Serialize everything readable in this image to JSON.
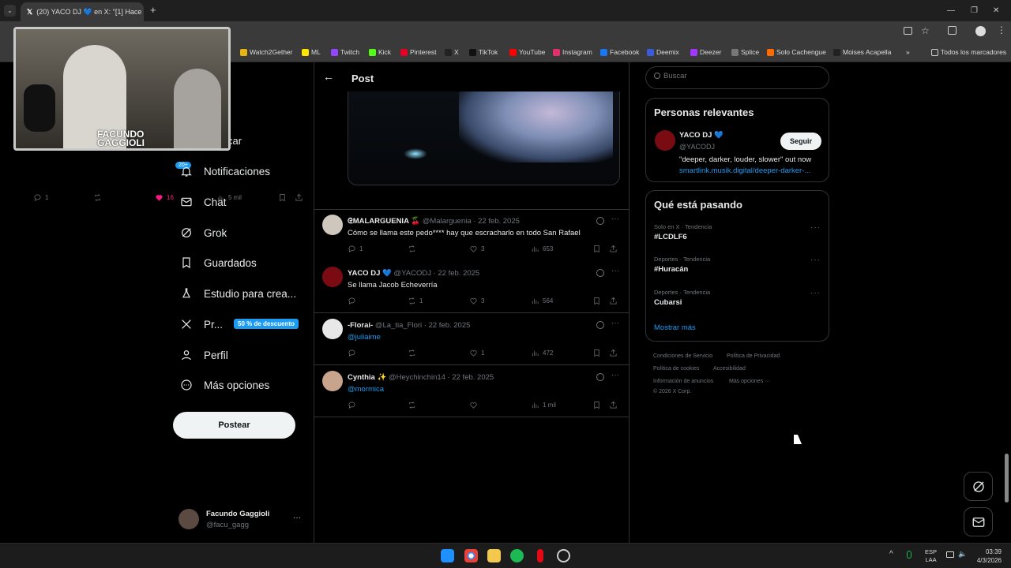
{
  "browser": {
    "tab_title": "(20) YACO DJ 💙 en X: \"[1] Hace",
    "bookmarks": [
      "Watch2Gether",
      "ML",
      "Twitch",
      "Kick",
      "Pinterest",
      "X",
      "TikTok",
      "YouTube",
      "Instagram",
      "Facebook",
      "Deemix",
      "Deezer",
      "Splice",
      "Solo Cachengue",
      "Moises Acapella"
    ],
    "all_bookmarks": "Todos los marcadores",
    "more": "»"
  },
  "overlay": {
    "name_line1": "FACUNDO",
    "name_line2": "GAGGIOLI"
  },
  "sidebar": {
    "partial_item": "car",
    "badge": "20+",
    "items": [
      "Notificaciones",
      "Chat",
      "Grok",
      "Guardados",
      "Estudio para crea...",
      "Pr...",
      "Perfil",
      "Más opciones"
    ],
    "premium_badge": "50 % de descuento",
    "post_button": "Postear",
    "user_name": "Facundo Gaggioli",
    "user_handle": "@facu_gagg",
    "user_more": "···"
  },
  "header": {
    "title": "Post"
  },
  "main_post": {
    "replies": "1",
    "likes": "16",
    "views": "5 mil"
  },
  "tweets": [
    {
      "name": "ᘓMALARGUENIA 🍒",
      "handle": "@Malarguenia · 22 feb. 2025",
      "text": "Cómo se llama este pedo**** hay que escracharlo en todo San Rafael",
      "replies": "1",
      "retweets": "",
      "likes": "3",
      "views": "653"
    },
    {
      "name": "YACO DJ 💙",
      "handle": "@YACODJ · 22 feb. 2025",
      "text": "Se llama Jacob Echeverría",
      "replies": "",
      "retweets": "1",
      "likes": "3",
      "views": "564"
    },
    {
      "name": "-Florai-",
      "handle": "@La_tia_Flori · 22 feb. 2025",
      "text": "@juliaime",
      "replies": "",
      "retweets": "",
      "likes": "1",
      "views": "472"
    },
    {
      "name": "Cynthia ✨",
      "handle": "@Heychinchin14 · 22 feb. 2025",
      "text": "@mormica",
      "replies": "",
      "retweets": "",
      "likes": "",
      "views": "1 mil"
    }
  ],
  "search": {
    "placeholder": "Buscar"
  },
  "relevant": {
    "title": "Personas relevantes",
    "name": "YACO DJ 💙",
    "handle": "@YACODJ",
    "follow": "Seguir",
    "bio": "\"deeper, darker, louder, slower\" out now",
    "link": "smartlink.musik.digital/deeper-darker-..."
  },
  "trending": {
    "title": "Qué está pasando",
    "items": [
      {
        "context": "Solo en X · Tendencia",
        "topic": "#LCDLF6"
      },
      {
        "context": "Deportes · Tendencia",
        "topic": "#Huracán"
      },
      {
        "context": "Deportes · Tendencia",
        "topic": "Cubarsi"
      }
    ],
    "show_more": "Mostrar más"
  },
  "footer": {
    "links": [
      "Condiciones de Servicio",
      "Política de Privacidad",
      "Política de cookies",
      "Accesibilidad",
      "Información de anuncios",
      "Más opciones ···"
    ],
    "copyright": "© 2026 X Corp."
  },
  "taskbar": {
    "lang1": "ESP",
    "lang2": "LAA",
    "time": "03:39",
    "date": "4/3/2026"
  },
  "colors": {
    "accent": "#1d9bf0",
    "like": "#f91880",
    "bg": "#000000"
  }
}
